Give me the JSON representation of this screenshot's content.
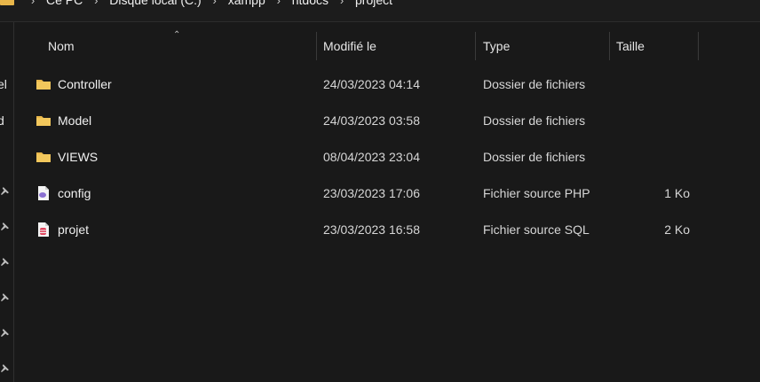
{
  "breadcrumb": {
    "items": [
      "Ce PC",
      "Disque local (C:)",
      "xampp",
      "htdocs",
      "project"
    ]
  },
  "nav": {
    "fragments": [
      "el",
      "d"
    ]
  },
  "columns": {
    "name": "Nom",
    "modified": "Modifié le",
    "type": "Type",
    "size": "Taille"
  },
  "files": [
    {
      "name": "Controller",
      "modified": "24/03/2023 04:14",
      "type": "Dossier de fichiers",
      "size": "",
      "icon": "folder-icon"
    },
    {
      "name": "Model",
      "modified": "24/03/2023 03:58",
      "type": "Dossier de fichiers",
      "size": "",
      "icon": "folder-icon"
    },
    {
      "name": "VIEWS",
      "modified": "08/04/2023 23:04",
      "type": "Dossier de fichiers",
      "size": "",
      "icon": "folder-icon"
    },
    {
      "name": "config",
      "modified": "23/03/2023 17:06",
      "type": "Fichier source PHP",
      "size": "1 Ko",
      "icon": "php-file-icon"
    },
    {
      "name": "projet",
      "modified": "23/03/2023 16:58",
      "type": "Fichier source SQL",
      "size": "2 Ko",
      "icon": "sql-file-icon"
    }
  ],
  "colors": {
    "background": "#191919",
    "folder": "#e8b64a",
    "php": "#8a6fd1",
    "sql": "#e0455e"
  }
}
